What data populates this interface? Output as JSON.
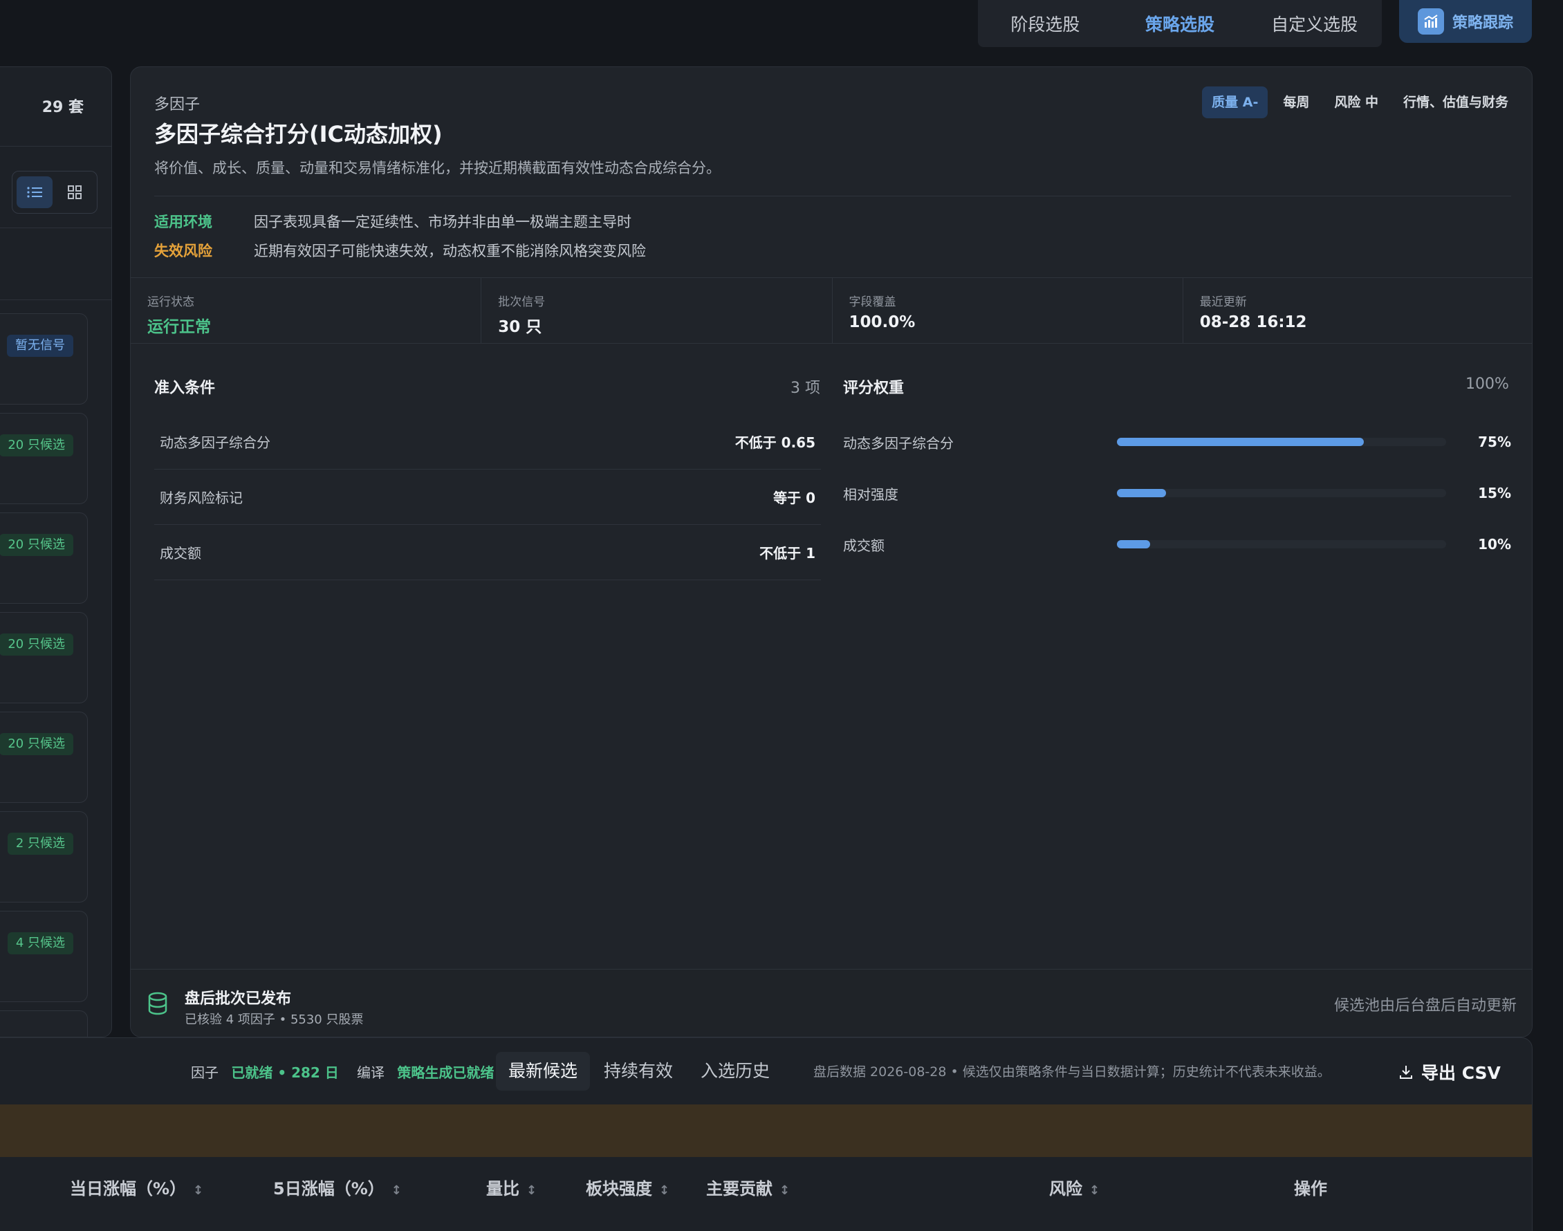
{
  "top_tabs": [
    {
      "label": "阶段选股",
      "active": false
    },
    {
      "label": "策略选股",
      "active": true
    },
    {
      "label": "自定义选股",
      "active": false
    }
  ],
  "track_button": {
    "label": "策略跟踪",
    "icon": "chart-bar-icon"
  },
  "sidebar": {
    "count_label": "29 套",
    "view_modes": [
      {
        "icon": "list-icon",
        "active": true
      },
      {
        "icon": "grid-icon",
        "active": false
      }
    ],
    "badges": [
      "暂无信号",
      "20 只候选",
      "20 只候选",
      "20 只候选",
      "20 只候选",
      "2 只候选",
      "4 只候选"
    ]
  },
  "strategy": {
    "category": "多因子",
    "title": "多因子综合打分(IC动态加权)",
    "description": "将价值、成长、质量、动量和交易情绪标准化，并按近期横截面有效性动态合成综合分。",
    "tags": [
      "质量 A-",
      "每周",
      "风险 中",
      "行情、估值与财务"
    ],
    "env_label": "适用环境",
    "env_value": "因子表现具备一定延续性、市场并非由单一极端主题主导时",
    "risk_label": "失效风险",
    "risk_value": "近期有效因子可能快速失效，动态权重不能消除风格突变风险",
    "stats": [
      {
        "label": "运行状态",
        "value": "运行正常"
      },
      {
        "label": "批次信号",
        "value": "30 只"
      },
      {
        "label": "字段覆盖",
        "value": "100.0%"
      },
      {
        "label": "最近更新",
        "value": "08-28 16:12"
      }
    ],
    "criteria_title": "准入条件",
    "criteria_count": "3 项",
    "criteria": [
      {
        "name": "动态多因子综合分",
        "value": "不低于 0.65"
      },
      {
        "name": "财务风险标记",
        "value": "等于 0"
      },
      {
        "name": "成交额",
        "value": "不低于 1"
      }
    ],
    "weights_title": "评分权重",
    "weights_total": "100%",
    "weights": [
      {
        "name": "动态多因子综合分",
        "percent": 75,
        "label": "75%"
      },
      {
        "name": "相对强度",
        "percent": 15,
        "label": "15%"
      },
      {
        "name": "成交额",
        "percent": 10,
        "label": "10%"
      }
    ],
    "footer": {
      "title": "盘后批次已发布",
      "subtitle": "已核验 4 项因子 • 5530 只股票",
      "right": "候选池由后台盘后自动更新"
    }
  },
  "toolbar": {
    "factor_label": "因子",
    "factor_value": "已就绪 • 282 日",
    "compile_label": "编译",
    "compile_value": "策略生成已就绪",
    "tabs": [
      {
        "label": "最新候选",
        "active": true
      },
      {
        "label": "持续有效",
        "active": false
      },
      {
        "label": "入选历史",
        "active": false
      }
    ],
    "note": "盘后数据 2026-08-28 • 候选仅由策略条件与当日数据计算；历史统计不代表未来收益。",
    "export_label": "导出 CSV"
  },
  "table": {
    "columns": [
      "当日涨幅（%）",
      "5日涨幅（%）",
      "量比",
      "板块强度",
      "主要贡献",
      "风险",
      "操作"
    ],
    "sort_glyph": "↕"
  },
  "colors": {
    "accent": "#5d9be6",
    "ok": "#4cc38a",
    "warn": "#e5a23a",
    "negative": "#e8475a"
  }
}
